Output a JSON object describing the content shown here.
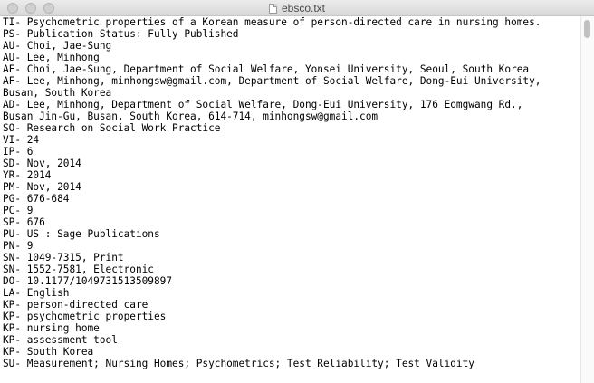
{
  "window": {
    "title": "ebsco.txt"
  },
  "lines": [
    "TI- Psychometric properties of a Korean measure of person-directed care in nursing homes.",
    "PS- Publication Status: Fully Published",
    "AU- Choi, Jae-Sung",
    "AU- Lee, Minhong",
    "AF- Choi, Jae-Sung, Department of Social Welfare, Yonsei University, Seoul, South Korea",
    "AF- Lee, Minhong, minhongsw@gmail.com, Department of Social Welfare, Dong-Eui University,",
    "Busan, South Korea",
    "AD- Lee, Minhong, Department of Social Welfare, Dong-Eui University, 176 Eomgwang Rd.,",
    "Busan Jin-Gu, Busan, South Korea, 614-714, minhongsw@gmail.com",
    "SO- Research on Social Work Practice",
    "VI- 24",
    "IP- 6",
    "SD- Nov, 2014",
    "YR- 2014",
    "PM- Nov, 2014",
    "PG- 676-684",
    "PC- 9",
    "SP- 676",
    "PU- US : Sage Publications",
    "PN- 9",
    "SN- 1049-7315, Print",
    "SN- 1552-7581, Electronic",
    "DO- 10.1177/1049731513509897",
    "LA- English",
    "KP- person-directed care",
    "KP- psychometric properties",
    "KP- nursing home",
    "KP- assessment tool",
    "KP- South Korea",
    "SU- Measurement; Nursing Homes; Psychometrics; Test Reliability; Test Validity"
  ]
}
